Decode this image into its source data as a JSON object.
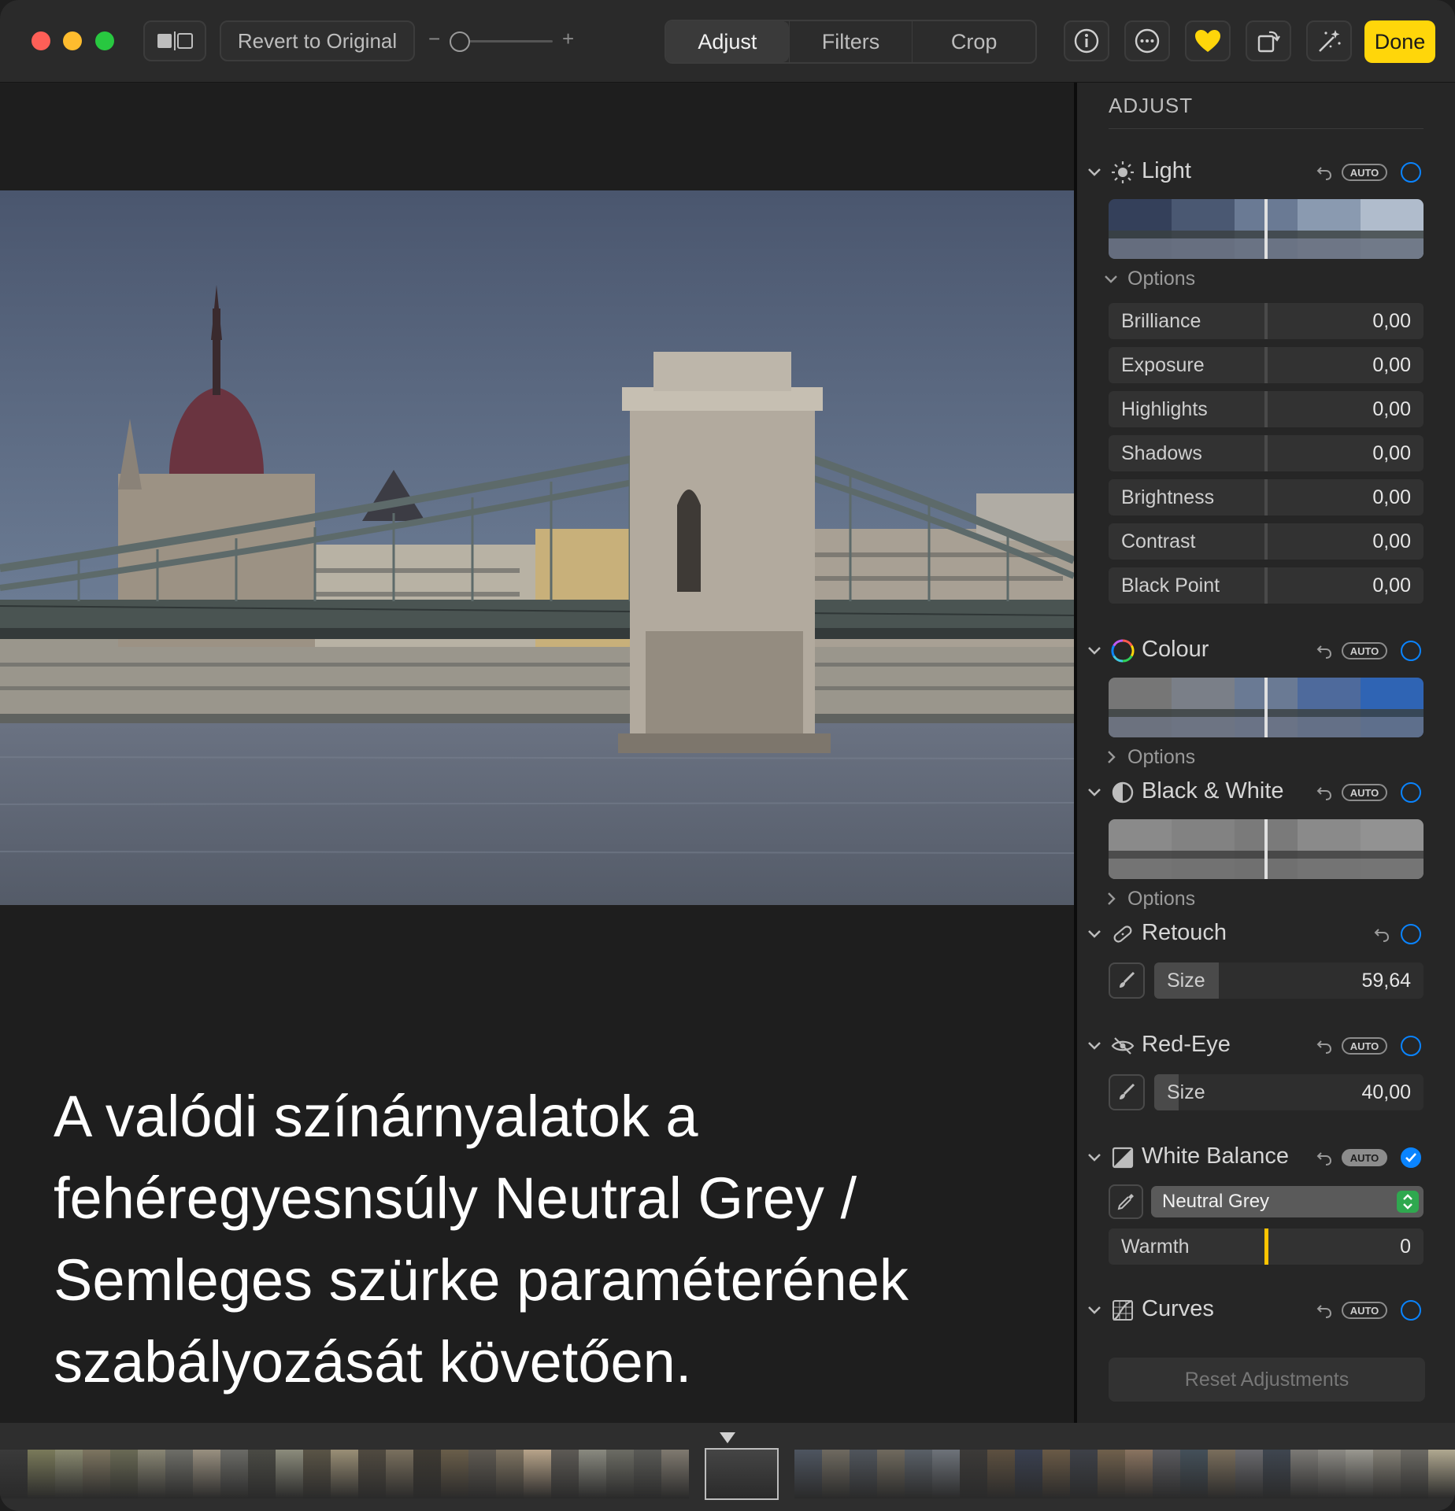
{
  "toolbar": {
    "revert_label": "Revert to Original",
    "zoom_minus": "−",
    "zoom_plus": "+",
    "tabs": [
      {
        "label": "Adjust",
        "active": true
      },
      {
        "label": "Filters",
        "active": false
      },
      {
        "label": "Crop",
        "active": false
      }
    ],
    "done_label": "Done",
    "accent_color": "#ffd60a",
    "icons": [
      "info-icon",
      "more-icon",
      "favorite-heart-icon",
      "rotate-icon",
      "auto-enhance-icon"
    ]
  },
  "caption": {
    "text": "A valódi színárnyalatok a fehéregyesnsúly Neutral Grey / Semleges szürke paraméterének szabályozását követően."
  },
  "sidebar": {
    "title": "ADJUST",
    "auto_label": "AUTO",
    "options_label": "Options",
    "light": {
      "label": "Light",
      "sliders": [
        {
          "name": "Brilliance",
          "value": "0,00"
        },
        {
          "name": "Exposure",
          "value": "0,00"
        },
        {
          "name": "Highlights",
          "value": "0,00"
        },
        {
          "name": "Shadows",
          "value": "0,00"
        },
        {
          "name": "Brightness",
          "value": "0,00"
        },
        {
          "name": "Contrast",
          "value": "0,00"
        },
        {
          "name": "Black Point",
          "value": "0,00"
        }
      ]
    },
    "colour": {
      "label": "Colour"
    },
    "bw": {
      "label": "Black & White"
    },
    "retouch": {
      "label": "Retouch",
      "size_label": "Size",
      "size_value": "59,64",
      "size_fraction": 0.24
    },
    "redeye": {
      "label": "Red-Eye",
      "size_label": "Size",
      "size_value": "40,00",
      "size_fraction": 0.09
    },
    "white_balance": {
      "label": "White Balance",
      "mode": "Neutral Grey",
      "warmth_label": "Warmth",
      "warmth_value": "0",
      "enabled": true
    },
    "curves": {
      "label": "Curves"
    },
    "reset_label": "Reset Adjustments"
  },
  "filmstrip": {
    "thumb_colors": [
      "#3a3a3a",
      "#7a7a5a",
      "#8a8a70",
      "#7d7560",
      "#6a6a55",
      "#8a8775",
      "#6e6e68",
      "#999080",
      "#6b6b66",
      "#4a4a44",
      "#8c8c7c",
      "#5a5446",
      "#9a8f76",
      "#504a40",
      "#7a705e",
      "#3e3a33",
      "#6a5e4a",
      "#5f5a52",
      "#7f7462",
      "#b8a48a",
      "#5d5a55",
      "#8a8a80",
      "#6c6c64",
      "#5a5a56",
      "#807a70",
      "#454545",
      "#4e5560",
      "#6f6a60",
      "#50555c",
      "#706a5e",
      "#5a6068",
      "#6e737a",
      "#3c3a38",
      "#5d5040",
      "#3a4050",
      "#6a5a46",
      "#3e4148",
      "#70604c",
      "#8a7460",
      "#5a5a5e",
      "#44505a",
      "#7a6e5c",
      "#6a6a6e",
      "#3f4650",
      "#7c7a76",
      "#8c8a84",
      "#9a9890",
      "#848076",
      "#6c6a64",
      "#b0a890",
      "#7a6e50",
      "#6a5c3e",
      "#4e5a2e",
      "#5a6a30",
      "#4a5a28",
      "#3a4a22"
    ]
  }
}
